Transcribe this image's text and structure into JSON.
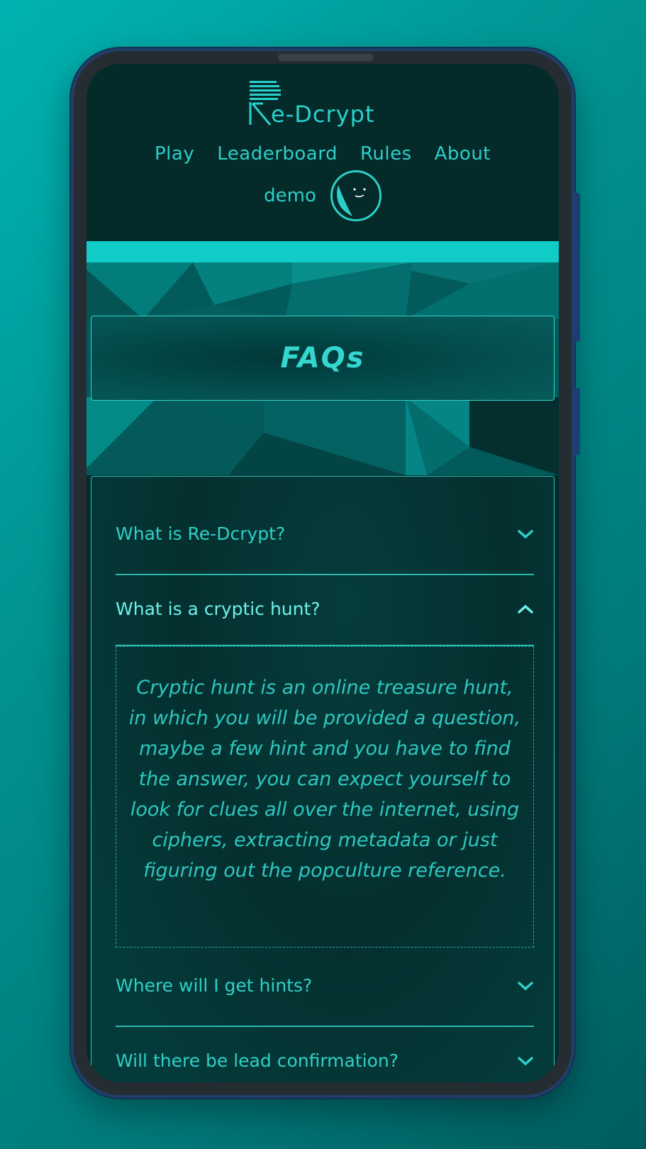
{
  "app": {
    "logo_text": "e-Dcrypt",
    "logo_initial": "R"
  },
  "nav": {
    "items": [
      "Play",
      "Leaderboard",
      "Rules",
      "About"
    ]
  },
  "user": {
    "name": "demo"
  },
  "page": {
    "title": "FAQs"
  },
  "faqs": [
    {
      "question": "What is Re-Dcrypt?",
      "expanded": false
    },
    {
      "question": "What is a cryptic hunt?",
      "expanded": true,
      "answer": "Cryptic hunt is an online treasure hunt, in which you will be provided a question, maybe a few hint and you have to find the answer, you can expect yourself to look for clues all over the internet, using ciphers, extracting metadata or just figuring out the popculture reference."
    },
    {
      "question": "Where will I get hints?",
      "expanded": false
    },
    {
      "question": "Will there be lead confirmation?",
      "expanded": false
    }
  ],
  "colors": {
    "accent": "#2ccfc8",
    "background": "#042a29",
    "page_bg": "#009896"
  },
  "icons": {
    "collapsed": "chevron-down-icon",
    "expanded": "chevron-up-icon"
  }
}
